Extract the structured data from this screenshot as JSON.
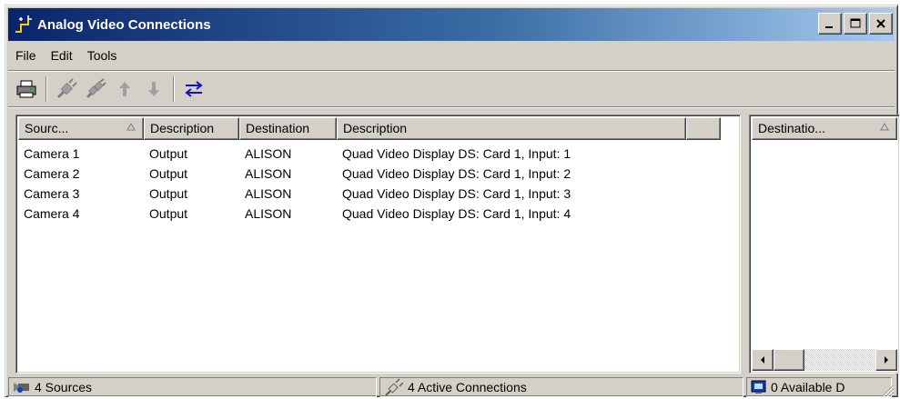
{
  "window": {
    "title": "Analog Video Connections",
    "title_buttons": {
      "minimize": "_",
      "maximize": "□",
      "close": "X"
    }
  },
  "menu": [
    "File",
    "Edit",
    "Tools"
  ],
  "toolbar": [
    "printer-icon",
    "connect-icon",
    "disconnect-icon",
    "arrow-up-icon",
    "arrow-down-icon",
    "swap-icon"
  ],
  "sources_table": {
    "headers": [
      "Sourc...",
      "Description",
      "Destination",
      "Description",
      ""
    ],
    "rows": [
      [
        "Camera 1",
        "Output",
        "ALISON",
        "Quad Video Display DS: Card 1, Input: 1"
      ],
      [
        "Camera 2",
        "Output",
        "ALISON",
        "Quad Video Display DS: Card 1, Input: 2"
      ],
      [
        "Camera 3",
        "Output",
        "ALISON",
        "Quad Video Display DS: Card 1, Input: 3"
      ],
      [
        "Camera 4",
        "Output",
        "ALISON",
        "Quad Video Display DS: Card 1, Input: 4"
      ]
    ]
  },
  "destinations_table": {
    "headers": [
      "Destinatio..."
    ]
  },
  "status": {
    "sources": "4 Sources",
    "connections": "4 Active Connections",
    "available": "0 Available D"
  },
  "colors": {
    "titlebar_start": "#0a246a",
    "titlebar_end": "#a6caf0",
    "face": "#d4d0c8"
  }
}
